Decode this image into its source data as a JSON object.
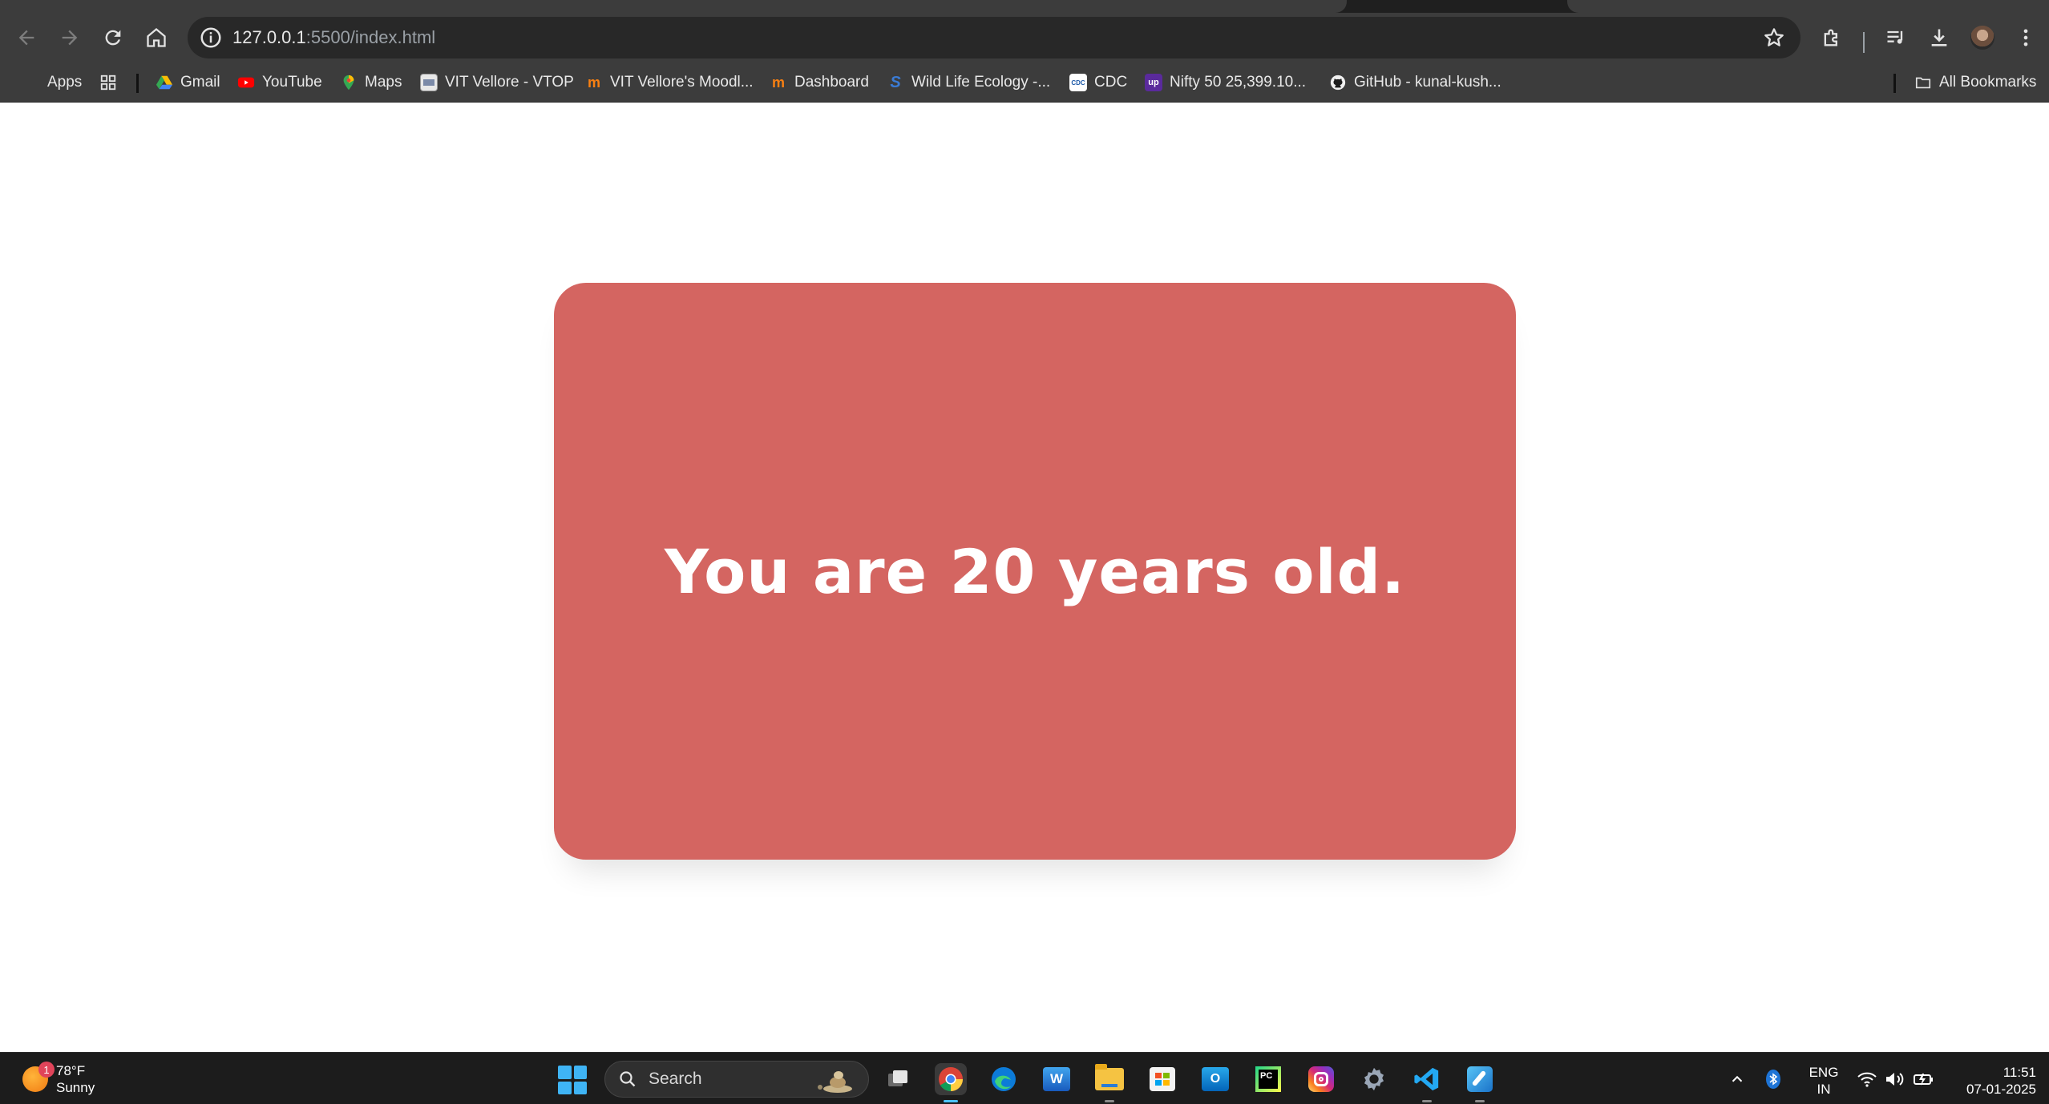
{
  "browser": {
    "url_host": "127.0.0.1",
    "url_path": ":5500/index.html"
  },
  "bookmarks": {
    "items": [
      {
        "label": "Apps",
        "icon": "apps-grid-icon"
      },
      {
        "label": "Gmail",
        "icon": "google-drive-icon"
      },
      {
        "label": "YouTube",
        "icon": "youtube-icon"
      },
      {
        "label": "Maps",
        "icon": "maps-pin-icon"
      },
      {
        "label": "VIT Vellore - VTOP",
        "icon": "vtop-icon"
      },
      {
        "label": "VIT Vellore's Moodl...",
        "icon": "moodle-icon"
      },
      {
        "label": "Dashboard",
        "icon": "moodle-icon"
      },
      {
        "label": "Wild Life Ecology -...",
        "icon": "s-icon"
      },
      {
        "label": "CDC",
        "icon": "cdc-icon"
      },
      {
        "label": "Nifty 50 25,399.10...",
        "icon": "upstox-icon"
      },
      {
        "label": "GitHub - kunal-kush...",
        "icon": "github-icon"
      }
    ],
    "all_bookmarks": "All Bookmarks"
  },
  "page": {
    "message": "You are 20 years old.",
    "card_color": "#d46561"
  },
  "taskbar": {
    "weather_temp": "78°F",
    "weather_desc": "Sunny",
    "weather_badge": "1",
    "search_label": "Search",
    "lang_line1": "ENG",
    "lang_line2": "IN",
    "time": "11:51",
    "date": "07-01-2025"
  }
}
